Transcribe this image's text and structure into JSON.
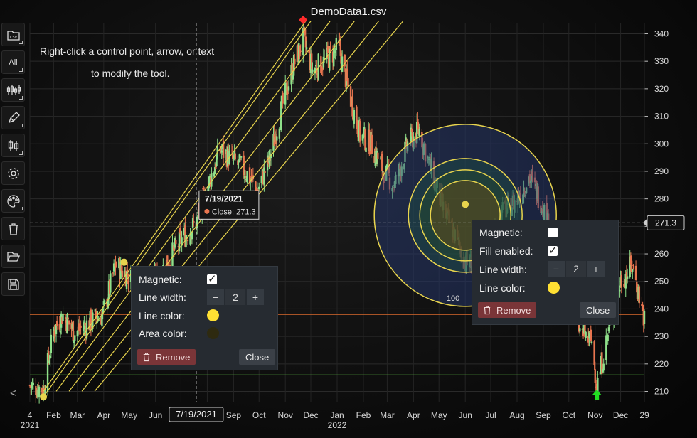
{
  "window": {
    "title": "DemoData1.csv"
  },
  "toolbar": {
    "buttons": [
      {
        "name": "csv-file",
        "label": "CSV",
        "icon": "folder-csv-icon"
      },
      {
        "name": "show-all",
        "label": "All",
        "icon": ""
      },
      {
        "name": "candles",
        "label": "",
        "icon": "candlestick-icon"
      },
      {
        "name": "draw-tools",
        "label": "",
        "icon": "pen-icon"
      },
      {
        "name": "chart-type",
        "label": "",
        "icon": "ohlc-icon"
      },
      {
        "name": "settings",
        "label": "",
        "icon": "gear-icon"
      },
      {
        "name": "themes",
        "label": "",
        "icon": "palette-icon"
      },
      {
        "name": "delete",
        "label": "",
        "icon": "trash-icon"
      },
      {
        "name": "open",
        "label": "",
        "icon": "folder-open-icon"
      },
      {
        "name": "save",
        "label": "",
        "icon": "save-icon"
      }
    ],
    "nav_prev": "<"
  },
  "hint": {
    "line1": "Right-click a control point, arrow, or text",
    "line2": "to modify the tool."
  },
  "tooltip": {
    "date": "7/19/2021",
    "label": "Close: 271.3"
  },
  "crosshair": {
    "x_label": "7/19/2021",
    "y_label": "271.3"
  },
  "panel_left": {
    "magnetic_label": "Magnetic:",
    "magnetic": true,
    "line_width_label": "Line width:",
    "line_width": "2",
    "minus": "−",
    "plus": "+",
    "line_color_label": "Line color:",
    "line_color": "#ffe033",
    "area_color_label": "Area color:",
    "area_color": "#2e2a10",
    "remove_label": "Remove",
    "close_label": "Close"
  },
  "panel_right": {
    "magnetic_label": "Magnetic:",
    "magnetic": false,
    "fill_label": "Fill enabled:",
    "fill": true,
    "line_width_label": "Line width:",
    "line_width": "2",
    "minus": "−",
    "plus": "+",
    "line_color_label": "Line color:",
    "line_color": "#ffe033",
    "remove_label": "Remove",
    "close_label": "Close"
  },
  "colors": {
    "up": "#8fe08a",
    "down": "#e8754f",
    "tool": "#e8d44d",
    "hline_orange": "#d9692c",
    "hline_green": "#59b341",
    "marker_high": "#ff2b2b",
    "marker_low": "#22dd22"
  },
  "chart_data": {
    "type": "candlestick",
    "title": "DemoData1.csv",
    "x_ticks": [
      "4",
      "Feb",
      "Mar",
      "Apr",
      "May",
      "Jun",
      "Jul",
      "Aug",
      "Sep",
      "Oct",
      "Nov",
      "Dec",
      "Jan",
      "Feb",
      "Mar",
      "Apr",
      "May",
      "Jun",
      "Jul",
      "Aug",
      "Sep",
      "Oct",
      "Nov",
      "Dec",
      "29"
    ],
    "x_year_labels": [
      "2021",
      "2022"
    ],
    "y_ticks": [
      210,
      220,
      230,
      240,
      250,
      260,
      270,
      280,
      290,
      300,
      310,
      320,
      330,
      340
    ],
    "ylim": [
      206,
      344
    ],
    "y_axis_position": "right",
    "grid": true,
    "close_trend": [
      [
        "2021-01-04",
        212
      ],
      [
        "2021-01-20",
        211
      ],
      [
        "2021-02-01",
        232
      ],
      [
        "2021-02-12",
        238
      ],
      [
        "2021-02-26",
        231
      ],
      [
        "2021-03-10",
        234
      ],
      [
        "2021-03-31",
        238
      ],
      [
        "2021-04-15",
        256
      ],
      [
        "2021-04-30",
        252
      ],
      [
        "2021-05-14",
        247
      ],
      [
        "2021-05-31",
        250
      ],
      [
        "2021-06-15",
        257
      ],
      [
        "2021-07-01",
        265
      ],
      [
        "2021-07-19",
        271.3
      ],
      [
        "2021-08-02",
        285
      ],
      [
        "2021-08-16",
        298
      ],
      [
        "2021-08-31",
        294
      ],
      [
        "2021-09-15",
        290
      ],
      [
        "2021-09-29",
        283
      ],
      [
        "2021-10-13",
        294
      ],
      [
        "2021-10-27",
        312
      ],
      [
        "2021-11-10",
        328
      ],
      [
        "2021-11-22",
        338
      ],
      [
        "2021-12-03",
        327
      ],
      [
        "2021-12-17",
        330
      ],
      [
        "2022-01-03",
        335
      ],
      [
        "2022-01-14",
        320
      ],
      [
        "2022-01-28",
        303
      ],
      [
        "2022-02-10",
        300
      ],
      [
        "2022-02-25",
        290
      ],
      [
        "2022-03-10",
        285
      ],
      [
        "2022-03-25",
        300
      ],
      [
        "2022-04-08",
        305
      ],
      [
        "2022-04-22",
        290
      ],
      [
        "2022-05-06",
        276
      ],
      [
        "2022-05-20",
        266
      ],
      [
        "2022-06-03",
        256
      ],
      [
        "2022-06-17",
        258
      ],
      [
        "2022-07-01",
        266
      ],
      [
        "2022-07-15",
        275
      ],
      [
        "2022-08-01",
        280
      ],
      [
        "2022-08-15",
        288
      ],
      [
        "2022-08-31",
        278
      ],
      [
        "2022-09-15",
        260
      ],
      [
        "2022-09-30",
        248
      ],
      [
        "2022-10-14",
        232
      ],
      [
        "2022-10-28",
        228
      ],
      [
        "2022-11-03",
        212
      ],
      [
        "2022-11-17",
        232
      ],
      [
        "2022-12-01",
        250
      ],
      [
        "2022-12-15",
        256
      ],
      [
        "2022-12-29",
        236
      ]
    ],
    "horizontal_lines": [
      238,
      216
    ],
    "crosshair_value": 271.3,
    "circle_levels": [
      "100"
    ],
    "labels": [
      "7/19/2021",
      "Close: 271.3",
      "271.3"
    ]
  }
}
